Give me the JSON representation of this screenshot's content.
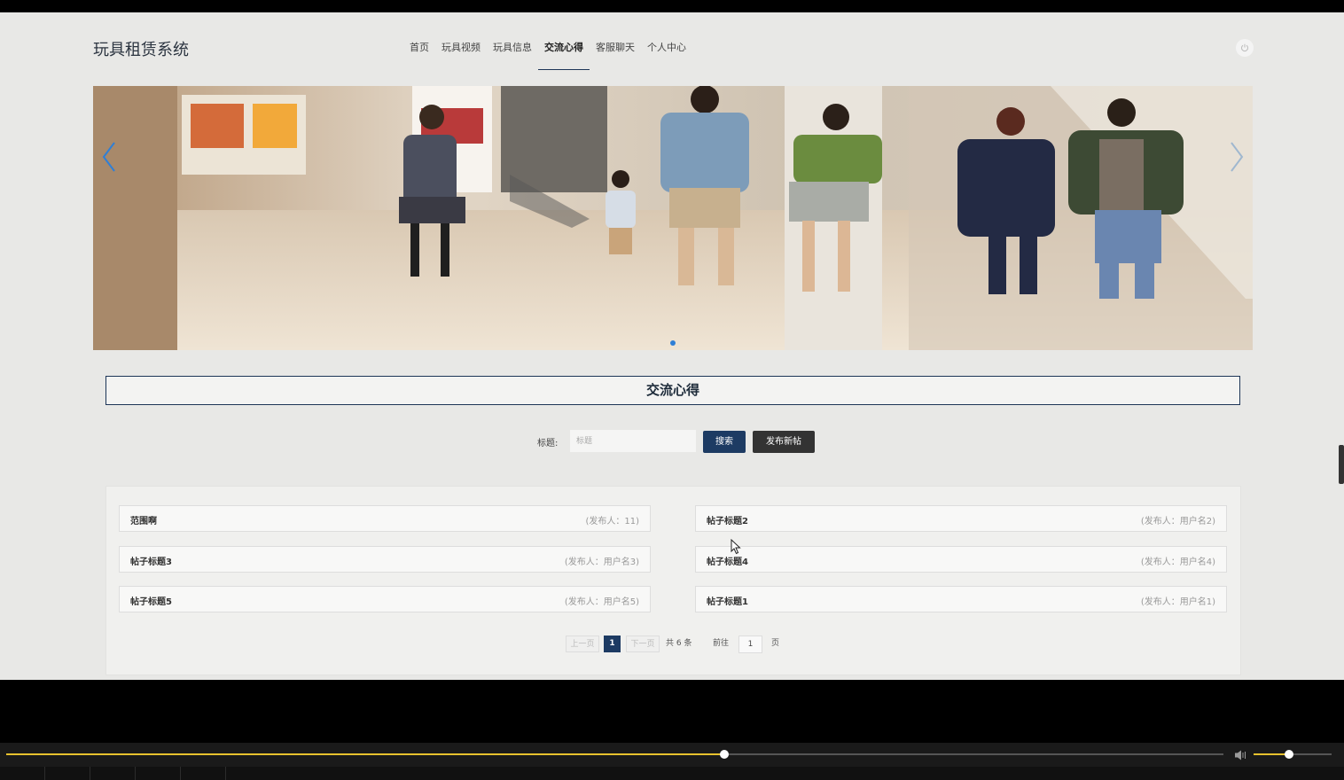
{
  "site": {
    "title": "玩具租赁系统"
  },
  "nav": [
    {
      "label": "首页",
      "active": false
    },
    {
      "label": "玩具视频",
      "active": false
    },
    {
      "label": "玩具信息",
      "active": false
    },
    {
      "label": "交流心得",
      "active": true
    },
    {
      "label": "客服聊天",
      "active": false
    },
    {
      "label": "个人中心",
      "active": false
    }
  ],
  "section": {
    "title": "交流心得"
  },
  "search": {
    "label": "标题:",
    "placeholder": "标题",
    "search_button": "搜索",
    "new_post_button": "发布新帖"
  },
  "posts": [
    {
      "title": "范围啊",
      "author": "(发布人：11)"
    },
    {
      "title": "帖子标题2",
      "author": "(发布人：用户名2)"
    },
    {
      "title": "帖子标题3",
      "author": "(发布人：用户名3)"
    },
    {
      "title": "帖子标题4",
      "author": "(发布人：用户名4)"
    },
    {
      "title": "帖子标题5",
      "author": "(发布人：用户名5)"
    },
    {
      "title": "帖子标题1",
      "author": "(发布人：用户名1)"
    }
  ],
  "pagination": {
    "prev": "上一页",
    "current": "1",
    "next": "下一页",
    "total": "共 6 条",
    "goto": "前往",
    "page_input": "1",
    "page_suffix": "页"
  },
  "player": {
    "progress": 0.59,
    "volume": 0.45
  },
  "colors": {
    "accent": "#1d3b63",
    "progress": "#e7c12e"
  }
}
